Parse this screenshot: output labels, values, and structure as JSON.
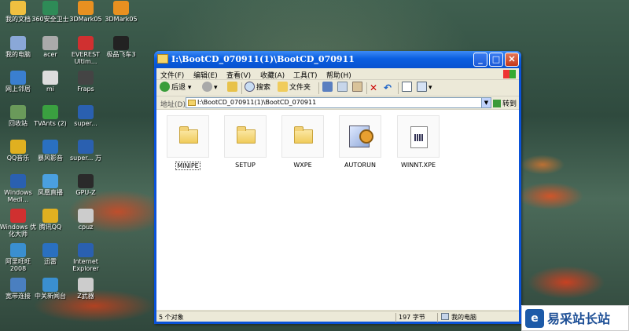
{
  "desktop_icons": [
    {
      "label": "我的文档"
    },
    {
      "label": "360安全卫士"
    },
    {
      "label": "3DMark05"
    },
    {
      "label": "3DMark05"
    },
    {
      "label": "我的电脑"
    },
    {
      "label": "acer"
    },
    {
      "label": "EVEREST Ultim..."
    },
    {
      "label": "极品飞车3"
    },
    {
      "label": "网上邻居"
    },
    {
      "label": "mi"
    },
    {
      "label": "Fraps"
    },
    {
      "label": "回收站"
    },
    {
      "label": "TVAnts (2)"
    },
    {
      "label": "super..."
    },
    {
      "label": "QQ音乐"
    },
    {
      "label": "暴风影音"
    },
    {
      "label": "super... 万"
    },
    {
      "label": "Windows Medi..."
    },
    {
      "label": "凤凰直播"
    },
    {
      "label": "GPU-Z"
    },
    {
      "label": "Windows 优化大师"
    },
    {
      "label": "腾讯QQ"
    },
    {
      "label": "cpuz"
    },
    {
      "label": "阿里旺旺 2008"
    },
    {
      "label": "迅雷"
    },
    {
      "label": "Internet Explorer"
    },
    {
      "label": "宽带连接"
    },
    {
      "label": "中关新闻台"
    },
    {
      "label": "Z武器"
    }
  ],
  "window": {
    "title": "I:\\BootCD_070911(1)\\BootCD_070911",
    "menu": [
      "文件(F)",
      "编辑(E)",
      "查看(V)",
      "收藏(A)",
      "工具(T)",
      "帮助(H)"
    ],
    "toolbar": {
      "back": "后退",
      "search": "搜索",
      "folders": "文件夹"
    },
    "address": {
      "label": "地址(D)",
      "value": "I:\\BootCD_070911(1)\\BootCD_070911",
      "go": "转到"
    },
    "files": [
      {
        "name": "MINIPE",
        "type": "folder"
      },
      {
        "name": "SETUP",
        "type": "folder"
      },
      {
        "name": "WXPE",
        "type": "folder"
      },
      {
        "name": "AUTORUN",
        "type": "autorun"
      },
      {
        "name": "WINNT.XPE",
        "type": "doc"
      }
    ],
    "status": {
      "objects": "5 个对象",
      "size": "197 字节",
      "location": "我的电脑"
    }
  },
  "watermark": {
    "text": "易采站长站"
  },
  "colors": {
    "title_bar": "#0852d0",
    "window_border": "#0a52d8",
    "window_bg": "#ece9d8"
  }
}
